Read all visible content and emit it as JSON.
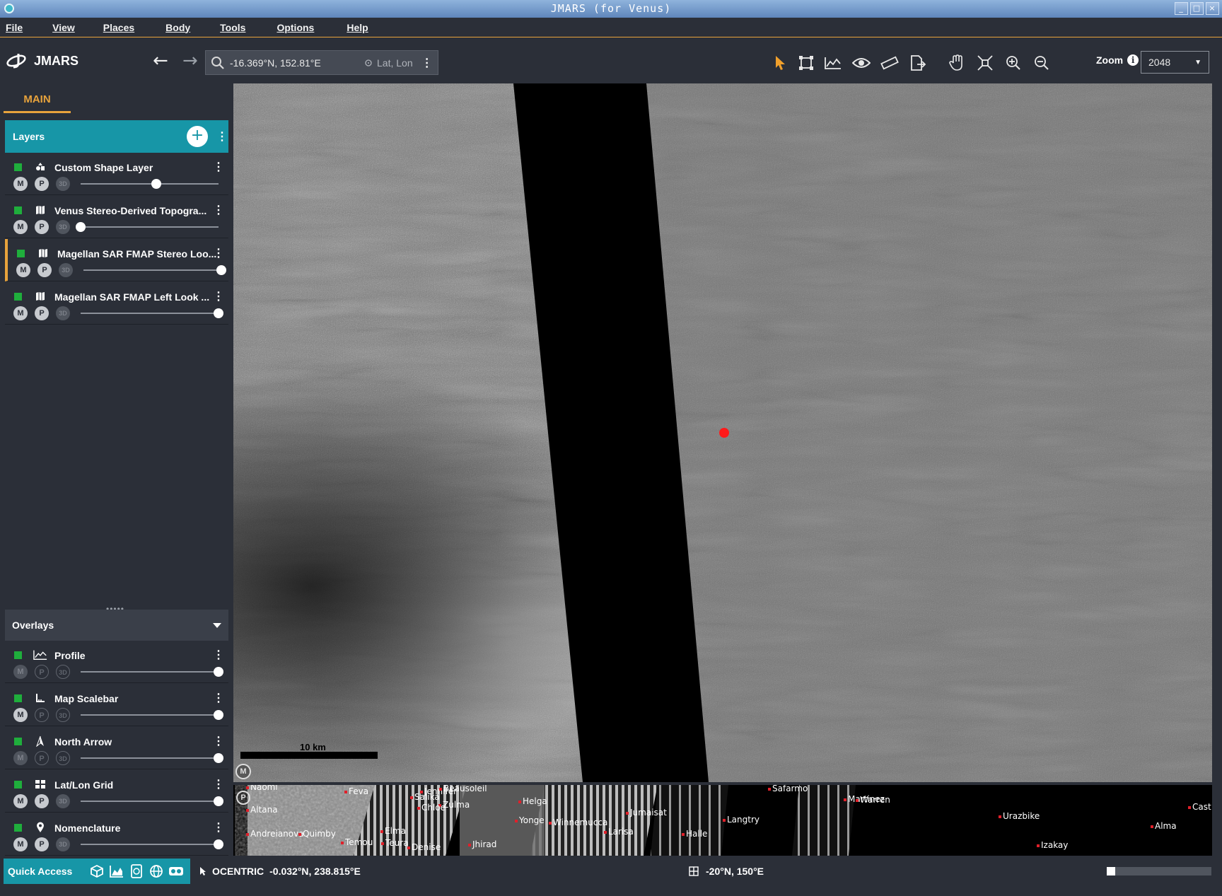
{
  "window": {
    "title": "JMARS (for Venus)"
  },
  "menu": [
    "File",
    "View",
    "Places",
    "Body",
    "Tools",
    "Options",
    "Help"
  ],
  "toolbar": {
    "logo": "JMARS",
    "search_value": "-16.369°N, 152.81°E",
    "coord_mode": "Lat, Lon",
    "tools": [
      "pointer-icon",
      "select-icon",
      "profile-icon",
      "eye-icon",
      "ruler-icon",
      "export-icon",
      "pan-hand-icon",
      "fit-icon",
      "zoom-in-icon",
      "zoom-out-icon"
    ],
    "zoom_label": "Zoom",
    "zoom_value": "2048"
  },
  "sidebar": {
    "tab": "MAIN",
    "layers_title": "Layers",
    "layers": [
      {
        "name": "Custom Shape Layer",
        "icon": "shapes-icon",
        "opacity": 0.55,
        "selected": false
      },
      {
        "name": "Venus Stereo-Derived Topogra...",
        "icon": "map-icon",
        "opacity": 0.0,
        "selected": false
      },
      {
        "name": "Magellan SAR FMAP Stereo Loo...",
        "icon": "map-icon",
        "opacity": 1.0,
        "selected": true
      },
      {
        "name": "Magellan SAR FMAP Left Look ...",
        "icon": "map-icon",
        "opacity": 1.0,
        "selected": false
      }
    ],
    "overlays_title": "Overlays",
    "overlays": [
      {
        "name": "Profile",
        "icon": "profile-icon",
        "opacity": 1.0
      },
      {
        "name": "Map Scalebar",
        "icon": "scalebar-icon",
        "opacity": 1.0
      },
      {
        "name": "North Arrow",
        "icon": "north-arrow-icon",
        "opacity": 1.0
      },
      {
        "name": "Lat/Lon Grid",
        "icon": "grid-icon",
        "opacity": 1.0
      },
      {
        "name": "Nomenclature",
        "icon": "pin-icon",
        "opacity": 1.0
      }
    ],
    "btn_m": "M",
    "btn_p": "P",
    "btn_3d": "3D"
  },
  "map": {
    "scalebar_label": "10 km",
    "m_badge": "M"
  },
  "panner": {
    "p_badge": "P",
    "places": [
      "Naomi",
      "Feva",
      "Jennifer",
      "Beausoleil",
      "Salika",
      "Zulma",
      "Chloe",
      "Helga",
      "Altana",
      "Yonge",
      "Winnemucca",
      "Jumaisat",
      "Larisa",
      "Langtry",
      "Halle",
      "Andreianova",
      "Quimby",
      "Elma",
      "Temou",
      "Teura",
      "Denise",
      "Jhirad",
      "Safarmo",
      "Martinez",
      "Warren",
      "Urazbike",
      "Cast",
      "Alma",
      "Izakay"
    ]
  },
  "status": {
    "quick_access": "Quick Access",
    "projection": "OCENTRIC",
    "cursor_coords": "-0.032°N, 238.815°E",
    "grid_coords": "-20°N, 150°E",
    "progress": 0.08
  }
}
